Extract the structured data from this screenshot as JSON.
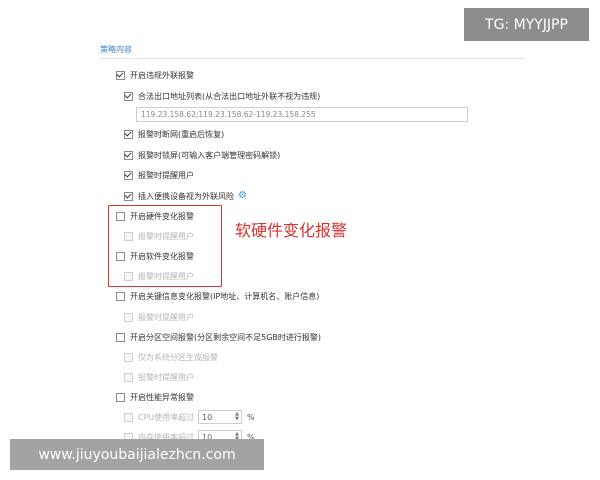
{
  "section_title": "策略内容",
  "items": {
    "violation_alarm": "开启违规外联报警",
    "legal_exit_list": "合法出口地址列表(从合法出口地址外联不视为违规)",
    "ip_range": "119.23.158.62;119.23.158.62-119.23.158.255",
    "disconnect_on_alarm": "报警时断网(重启后恢复)",
    "lock_screen_on_alarm": "报警时锁屏(可输入客户端管理密码解锁)",
    "notify_user_1": "报警时提醒用户",
    "portable_device_risk": "插入便携设备视为外联风险",
    "hardware_change": "开启硬件变化报警",
    "hardware_notify": "报警时提醒用户",
    "software_change": "开启软件变化报警",
    "software_notify": "报警时提醒用户",
    "key_info_change": "开启关键信息变化报警(IP地址、计算机名、账户信息)",
    "key_info_notify": "报警时提醒用户",
    "partition_space": "开启分区空间报警(分区剩余空间不足5GB时进行报警)",
    "system_partition_only": "仅为系统分区生成报警",
    "partition_notify": "报警时提醒用户",
    "performance_alarm": "开启性能异常报警",
    "cpu_usage": "CPU使用率超过",
    "cpu_value": "10",
    "mem_usage": "内存使用率超过",
    "mem_value": "10",
    "percent": "%"
  },
  "annotation": "软硬件变化报警",
  "watermarks": {
    "tg": "TG: MYYJJPP",
    "url": "www.jiuyoubaijialezhcn.com"
  },
  "colors": {
    "accent": "#3a82c4",
    "highlight_red": "#d7373b"
  },
  "icons": {
    "settings": "gear-icon"
  }
}
